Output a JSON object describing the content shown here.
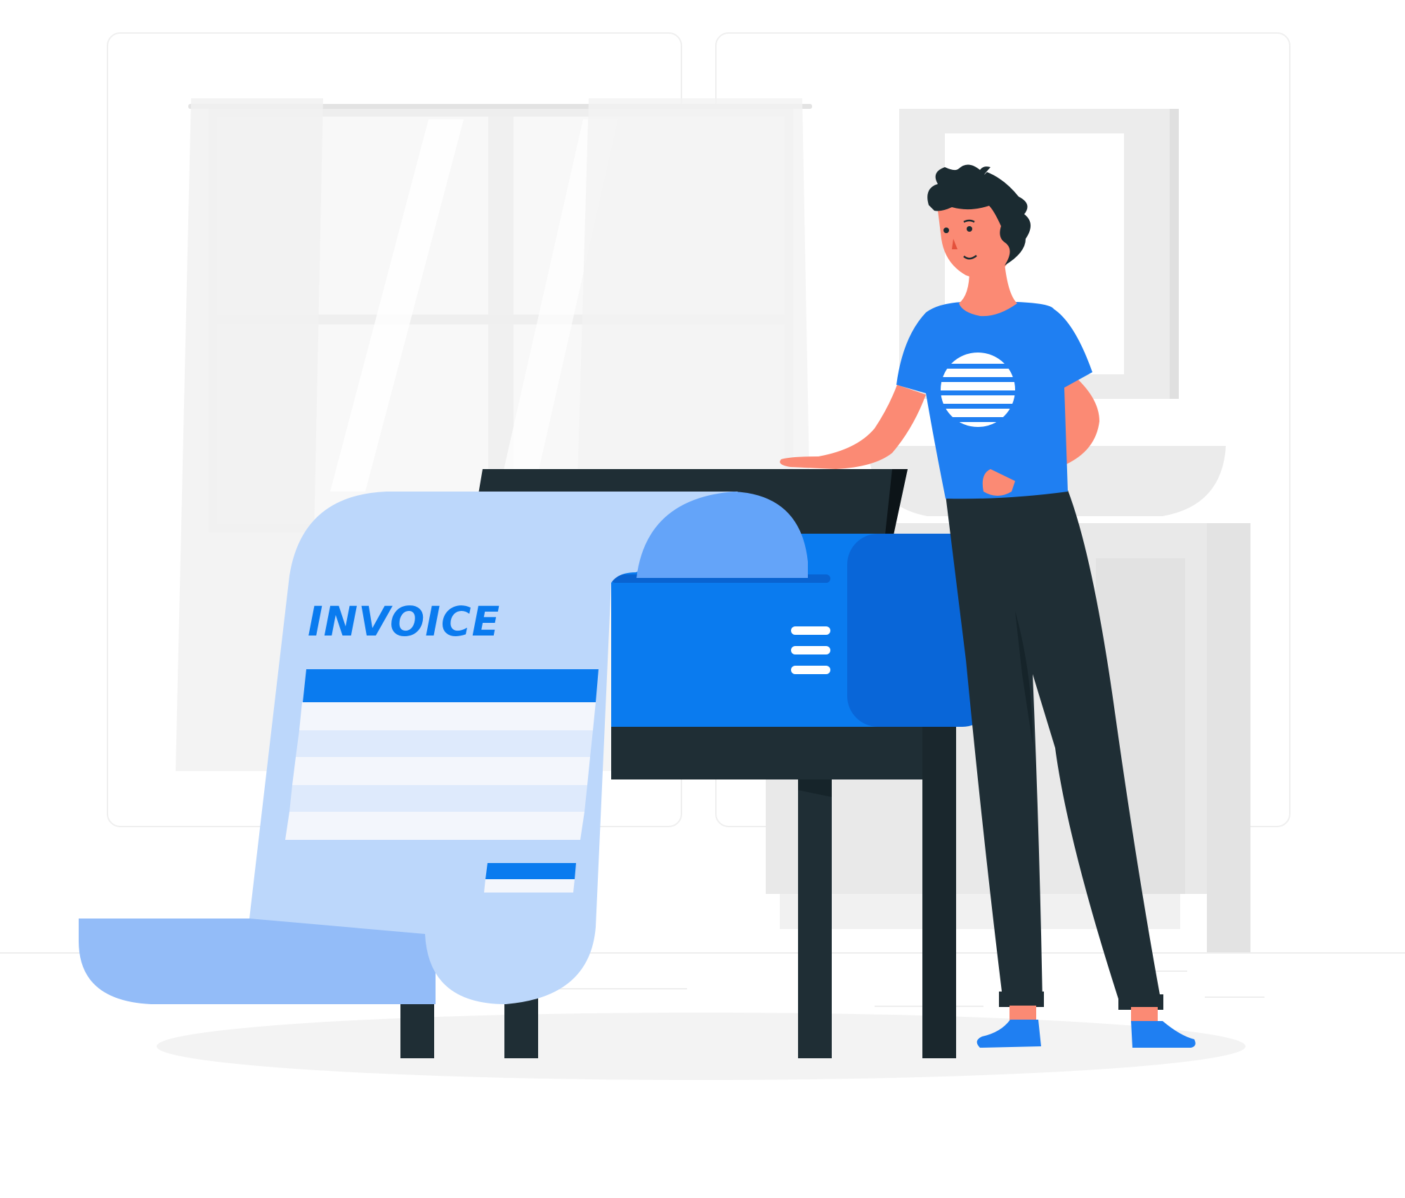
{
  "invoice": {
    "title": "INVOICE"
  },
  "colors": {
    "background": "#ffffff",
    "wall_panel": "#f7f7f7",
    "panel_border": "#ededed",
    "shadow": "#f3f3f3",
    "window_glass": "#fafafa",
    "window_frame": "#eeeeee",
    "curtain": "#f2f2f2",
    "cabinet": "#e8e8e8",
    "paper_light": "#bcd7fb",
    "paper_mid": "#93bcf8",
    "paper_fold": "#64a4f9",
    "accent_blue": "#0a7bef",
    "accent_blue_bright": "#1f7ff2",
    "printer_side": "#0966d8",
    "dark": "#1f2e35",
    "darker": "#16242a",
    "skin": "#fb8a74",
    "hair": "#1b2b31",
    "row_light": "#f3f6fc",
    "row_alt": "#deeafc",
    "white": "#ffffff"
  },
  "icons": {
    "printer_menu": "hamburger-menu-icon",
    "shirt_print": "striped-sun-icon"
  }
}
